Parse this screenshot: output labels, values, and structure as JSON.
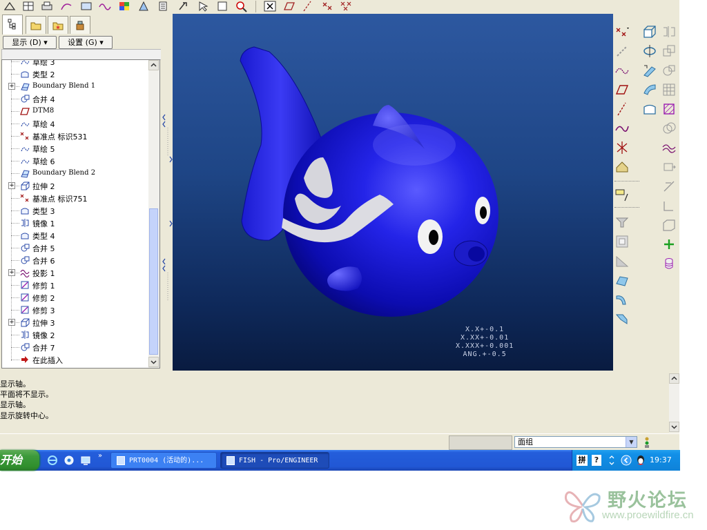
{
  "model_tree": {
    "display_menu": "显示 (D)",
    "settings_menu": "设置 (G)",
    "items": [
      {
        "label": "草绘 3",
        "icon": "sketch-icon",
        "expandable": false
      },
      {
        "label": "类型 2",
        "icon": "style-surface-icon",
        "expandable": false
      },
      {
        "label": "Boundary Blend 1",
        "icon": "boundary-blend-icon",
        "expandable": true
      },
      {
        "label": "合并 4",
        "icon": "merge-icon",
        "expandable": false
      },
      {
        "label": "DTM8",
        "icon": "datum-plane-icon",
        "expandable": false
      },
      {
        "label": "草绘 4",
        "icon": "sketch-icon",
        "expandable": false
      },
      {
        "label": "基准点 标识531",
        "icon": "datum-point-icon",
        "expandable": false
      },
      {
        "label": "草绘 5",
        "icon": "sketch-icon",
        "expandable": false
      },
      {
        "label": "草绘 6",
        "icon": "sketch-icon",
        "expandable": false
      },
      {
        "label": "Boundary Blend 2",
        "icon": "boundary-blend-icon",
        "expandable": false
      },
      {
        "label": "拉伸 2",
        "icon": "extrude-icon",
        "expandable": true
      },
      {
        "label": "基准点 标识751",
        "icon": "datum-point-icon",
        "expandable": false
      },
      {
        "label": "类型 3",
        "icon": "style-surface-icon",
        "expandable": false
      },
      {
        "label": "镜像 1",
        "icon": "mirror-icon",
        "expandable": false
      },
      {
        "label": "类型 4",
        "icon": "style-surface-icon",
        "expandable": false
      },
      {
        "label": "合并 5",
        "icon": "merge-icon",
        "expandable": false
      },
      {
        "label": "合并 6",
        "icon": "merge-icon",
        "expandable": false
      },
      {
        "label": "投影 1",
        "icon": "projection-icon",
        "expandable": true
      },
      {
        "label": "修剪 1",
        "icon": "trim-icon",
        "expandable": false
      },
      {
        "label": "修剪 2",
        "icon": "trim-icon",
        "expandable": false
      },
      {
        "label": "修剪 3",
        "icon": "trim-icon",
        "expandable": false
      },
      {
        "label": "拉伸 3",
        "icon": "extrude-icon",
        "expandable": true
      },
      {
        "label": "镜像 2",
        "icon": "mirror-icon",
        "expandable": false
      },
      {
        "label": "合并 7",
        "icon": "merge-icon",
        "expandable": false
      },
      {
        "label": "在此插入",
        "icon": "insert-here-arrow-icon",
        "expandable": false
      }
    ]
  },
  "viewport": {
    "tolerance_lines": [
      "X.X+-0.1",
      "X.XX+-0.01",
      "X.XXX+-0.001",
      "ANG.+-0.5"
    ]
  },
  "messages": [
    "显示轴。",
    "平面将不显示。",
    "显示轴。",
    "显示旋转中心。"
  ],
  "status": {
    "filter_value": "面组"
  },
  "taskbar": {
    "start_label": "开始",
    "tasks": [
      {
        "label": "PRT0004 (活动的)...",
        "active": false
      },
      {
        "label": "FISH - Pro/ENGINEER",
        "active": true
      }
    ],
    "clock": "19:37"
  },
  "watermark": {
    "title": "野火论坛",
    "url": "www.proewildfire.cn"
  },
  "colors": {
    "viewport_top": "#2d58a0",
    "viewport_bottom": "#091b40",
    "fish_body": "#1414c8",
    "taskbar": "#245edb",
    "start_button": "#3d9a3b"
  }
}
